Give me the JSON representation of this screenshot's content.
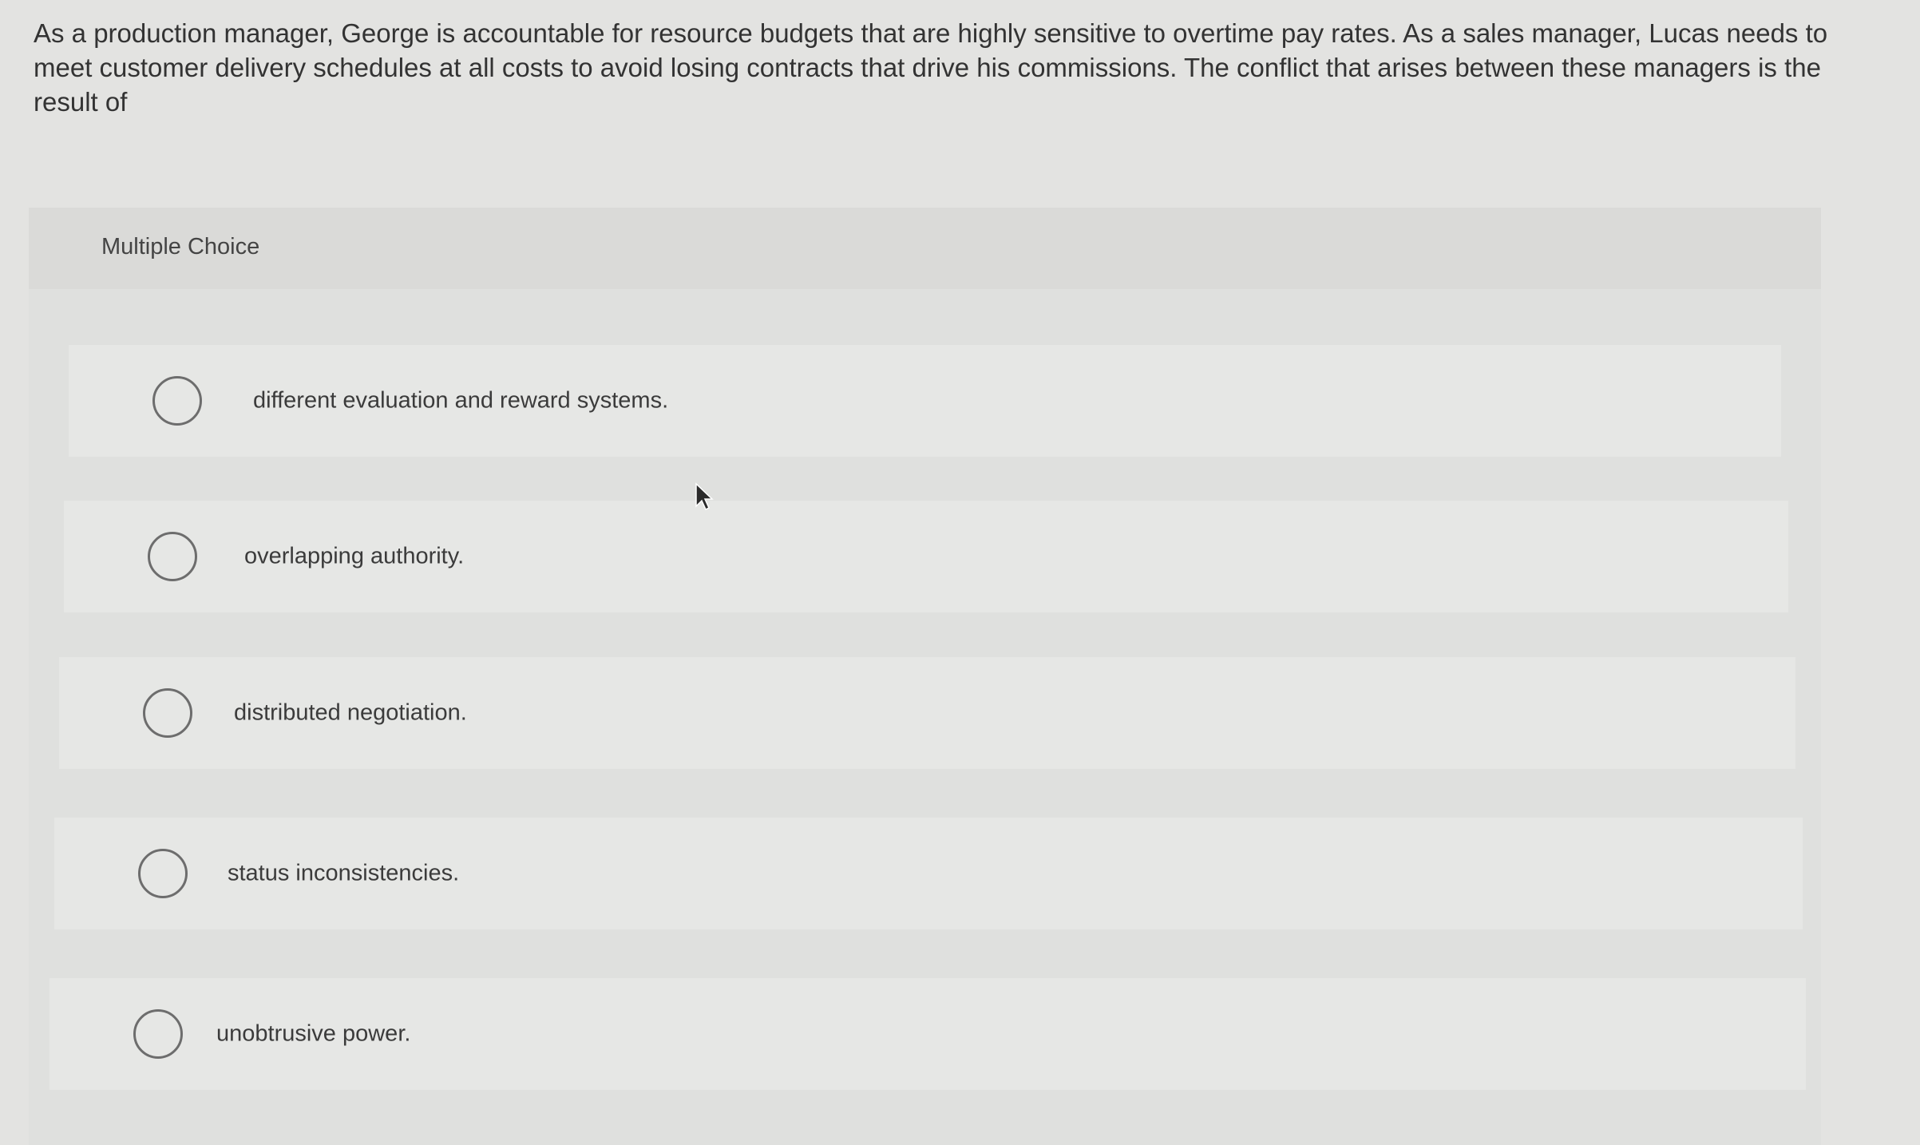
{
  "question": {
    "text": "As a production manager, George is accountable for resource budgets that are highly sensitive to overtime pay rates. As a sales manager, Lucas needs to meet customer delivery schedules at all costs to avoid losing contracts that drive his commissions. The conflict that arises between these managers is the result of"
  },
  "multiple_choice": {
    "label": "Multiple Choice",
    "options": [
      {
        "label": "different evaluation and reward systems.",
        "selected": false
      },
      {
        "label": "overlapping authority.",
        "selected": false
      },
      {
        "label": "distributed negotiation.",
        "selected": false
      },
      {
        "label": "status inconsistencies.",
        "selected": false
      },
      {
        "label": "unobtrusive power.",
        "selected": false
      }
    ]
  },
  "icons": {
    "cursor": "mouse-pointer-icon",
    "radio": "radio-button-icon"
  },
  "colors": {
    "background": "#e3e3e1",
    "panel": "#dfe0de",
    "option_row": "#e6e7e5",
    "radio_border": "#6d6d6d",
    "text": "#333333"
  }
}
